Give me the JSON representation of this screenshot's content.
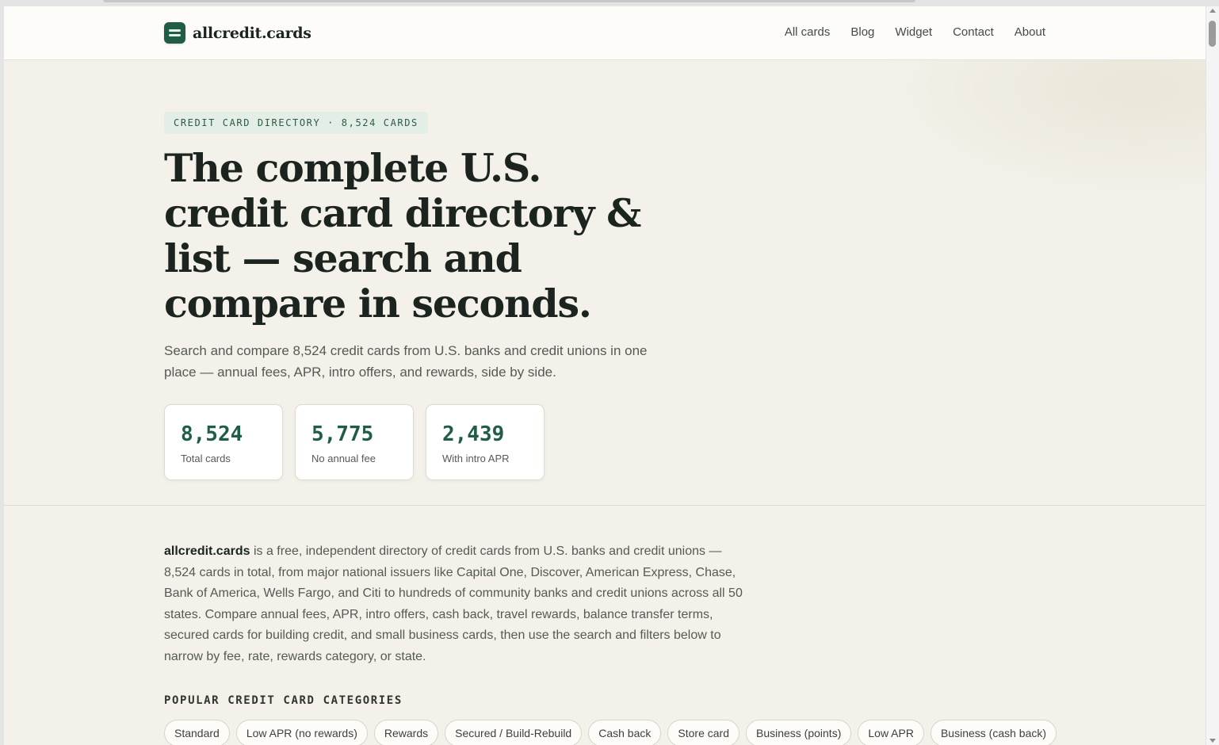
{
  "header": {
    "logo_text": "allcredit.cards",
    "nav": [
      "All cards",
      "Blog",
      "Widget",
      "Contact",
      "About"
    ]
  },
  "hero": {
    "eyebrow": "CREDIT CARD DIRECTORY · 8,524 CARDS",
    "title": "The complete U.S. credit card directory & list — search and compare in seconds.",
    "subtitle": "Search and compare 8,524 credit cards from U.S. banks and credit unions in one place — annual fees, APR, intro offers, and rewards, side by side.",
    "stats": [
      {
        "value": "8,524",
        "label": "Total cards"
      },
      {
        "value": "5,775",
        "label": "No annual fee"
      },
      {
        "value": "2,439",
        "label": "With intro APR"
      }
    ]
  },
  "intro": {
    "brand": "allcredit.cards",
    "text": " is a free, independent directory of credit cards from U.S. banks and credit unions — 8,524 cards in total, from major national issuers like Capital One, Discover, American Express, Chase, Bank of America, Wells Fargo, and Citi to hundreds of community banks and credit unions across all 50 states. Compare annual fees, APR, intro offers, cash back, travel rewards, balance transfer terms, secured cards for building credit, and small business cards, then use the search and filters below to narrow by fee, rate, rewards category, or state."
  },
  "categories": {
    "heading": "POPULAR CREDIT CARD CATEGORIES",
    "items": [
      "Standard",
      "Low APR (no rewards)",
      "Rewards",
      "Secured / Build-Rebuild",
      "Cash back",
      "Store card",
      "Business (points)",
      "Low APR",
      "Business (cash back)"
    ]
  },
  "colors": {
    "brand": "#1f5e44",
    "page_bg": "#f3f1ea",
    "eyebrow_bg": "#e3eee6"
  }
}
